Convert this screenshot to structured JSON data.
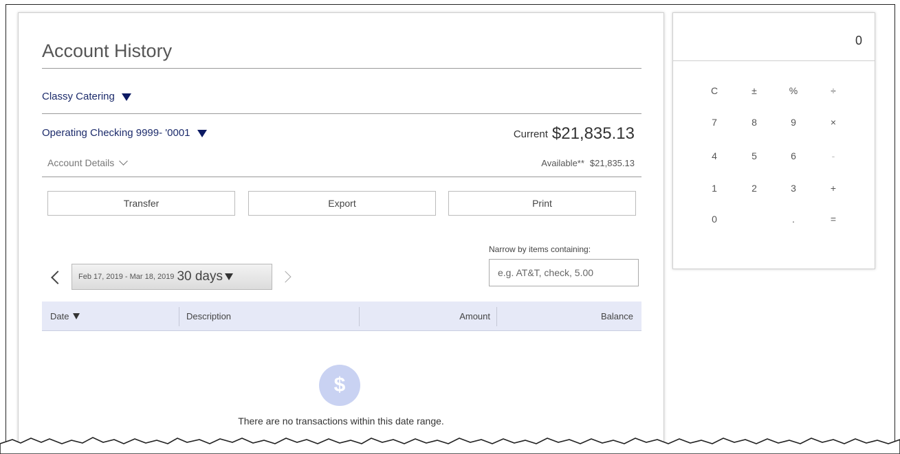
{
  "title": "Account History",
  "company": {
    "name": "Classy Catering"
  },
  "account": {
    "name": "Operating Checking 9999- '0001"
  },
  "balances": {
    "current_label": "Current",
    "current_amount": "$21,835.13",
    "available_label": "Available**",
    "available_amount": "$21,835.13"
  },
  "account_details_label": "Account Details",
  "actions": {
    "transfer": "Transfer",
    "export": "Export",
    "print": "Print"
  },
  "filter": {
    "label": "Narrow by items containing:",
    "placeholder": "e.g. AT&T, check, 5.00"
  },
  "date_range": {
    "range": "Feb 17, 2019 - Mar 18, 2019",
    "days": "30 days"
  },
  "table": {
    "columns": {
      "date": "Date",
      "description": "Description",
      "amount": "Amount",
      "balance": "Balance"
    },
    "empty_message": "There are no transactions within this date range."
  },
  "calculator": {
    "display": "0",
    "keys": {
      "clear": "C",
      "plusminus": "±",
      "percent": "%",
      "divide": "÷",
      "seven": "7",
      "eight": "8",
      "nine": "9",
      "multiply": "×",
      "four": "4",
      "five": "5",
      "six": "6",
      "minus": "-",
      "one": "1",
      "two": "2",
      "three": "3",
      "plus": "+",
      "zero": "0",
      "decimal": ".",
      "equals": "="
    }
  },
  "colors": {
    "accent_navy": "#1c2b6b",
    "table_header_bg": "#e6e9f7",
    "empty_icon_bg": "#c9d2f2"
  },
  "icons": {
    "empty_state": "$"
  }
}
